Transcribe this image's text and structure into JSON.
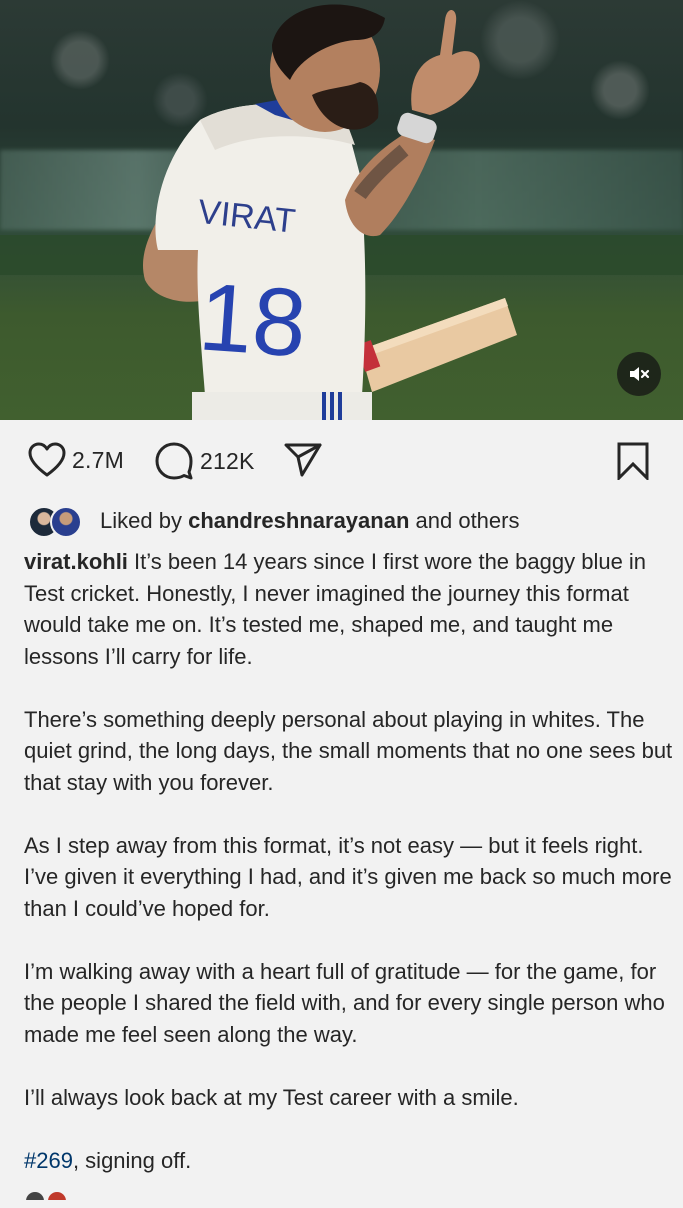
{
  "post": {
    "media": {
      "jersey_name": "VIRAT",
      "jersey_number": "18",
      "audio": "muted",
      "mute_icon": "speaker-muted-icon"
    },
    "actions": {
      "likes": "2.7M",
      "comments": "212K",
      "like_icon": "heart-icon",
      "comment_icon": "comment-bubble-icon",
      "share_icon": "send-icon",
      "save_icon": "bookmark-icon"
    },
    "liked_by": {
      "prefix": "Liked by",
      "name": "chandreshnarayanan",
      "suffix": "and others"
    },
    "caption": {
      "username": "virat.kohli",
      "p1": "It’s been 14 years since I first wore the baggy blue in Test cricket. Honestly, I never imagined the journey this format would take me on. It’s tested me, shaped me, and taught me lessons I’ll carry for life.",
      "p2": "There’s something deeply personal about playing in whites. The quiet grind, the long days, the small moments that no one sees but that stay with you forever.",
      "p3": "As I step away from this format, it’s not easy — but it feels right. I’ve given it everything I had, and it’s given me back so much more than I could’ve hoped for.",
      "p4": "I’m walking away with a heart full of gratitude — for the game, for the people I shared the field with, and for every single person who made me feel seen along the way.",
      "p5": "I’ll always look back at my Test career with a smile.",
      "hashtag": "#269",
      "p6_rest": ", signing off."
    }
  }
}
